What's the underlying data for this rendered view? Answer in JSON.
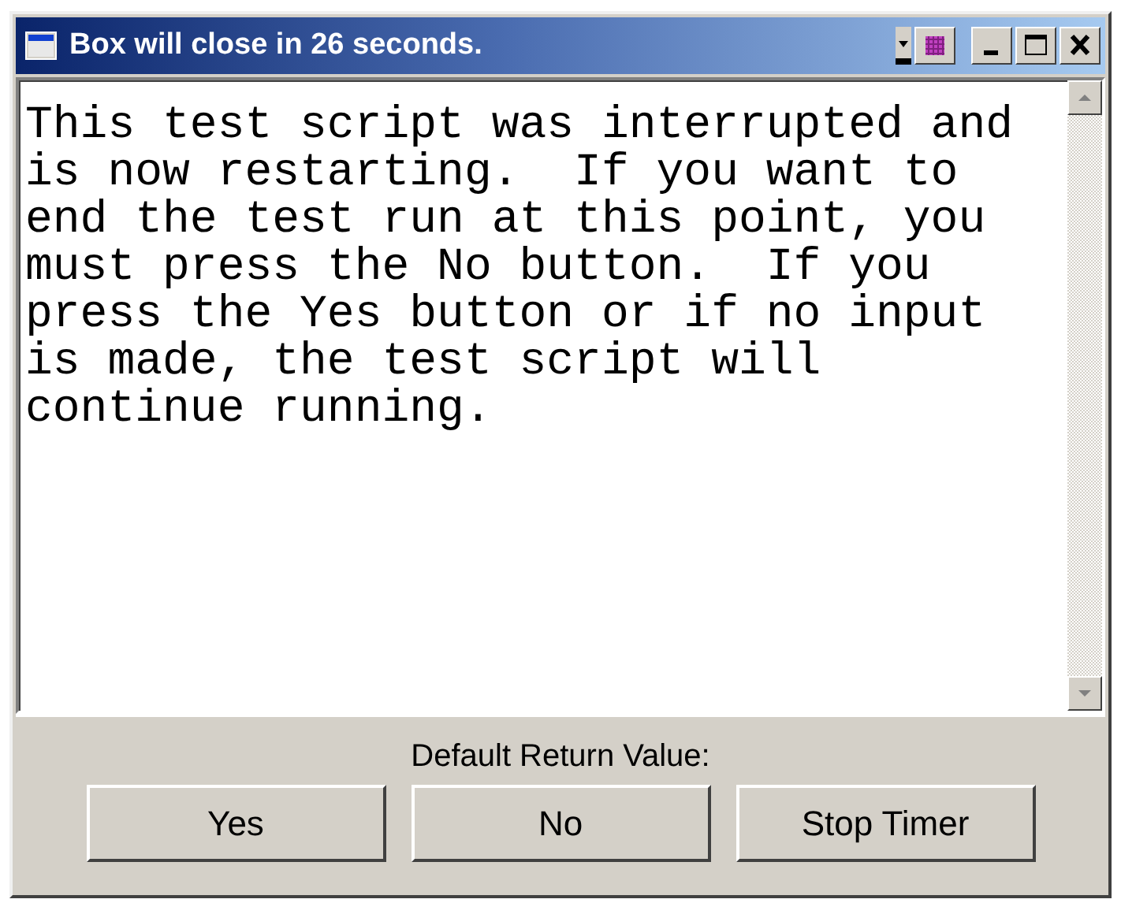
{
  "window": {
    "title": "Box will close in 26 seconds."
  },
  "message": "This test script was interrupted and is now restarting.  If you want to end the test run at this point, you must press the No button.  If you press the Yes button or if no input is made, the test script will continue running.",
  "footer": {
    "label": "Default Return Value:",
    "buttons": [
      "Yes",
      "No",
      "Stop Timer"
    ]
  }
}
